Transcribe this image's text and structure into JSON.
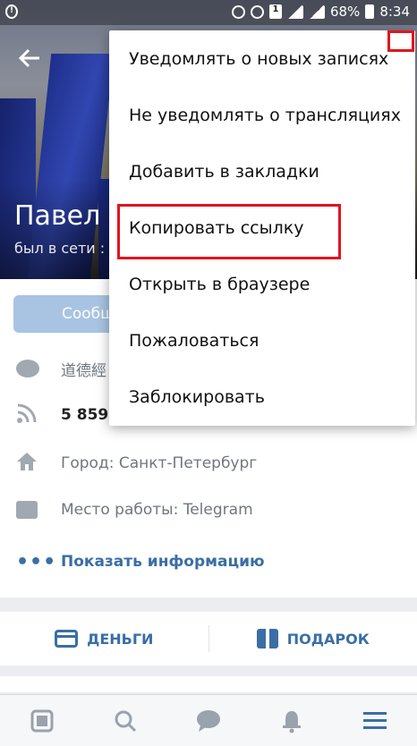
{
  "status_bar": {
    "battery_percent": "68%",
    "time": "8:34",
    "sim_label": "1"
  },
  "profile": {
    "name": "Павел Д",
    "status": "был в сети :",
    "message_button": "Сообщ"
  },
  "info_rows": [
    {
      "icon": "speech-bubble-icon",
      "text": "道德經"
    },
    {
      "icon": "rss-icon",
      "text": "5 859 "
    },
    {
      "icon": "home-icon",
      "text": "Город: Санкт-Петербург"
    },
    {
      "icon": "briefcase-icon",
      "text": "Место работы: Telegram"
    },
    {
      "icon": "more-dots-icon",
      "text": "Показать информацию"
    }
  ],
  "actions": {
    "money_label": "ДЕНЬГИ",
    "gift_label": "ПОДАРОК"
  },
  "menu": {
    "items": [
      "Уведомлять о новых записях",
      "Не уведомлять о трансляциях",
      "Добавить в закладки",
      "Копировать ссылку",
      "Открыть в браузере",
      "Пожаловаться",
      "Заблокировать"
    ]
  },
  "bottom_nav": [
    {
      "icon": "news-feed-icon"
    },
    {
      "icon": "search-icon"
    },
    {
      "icon": "messages-icon"
    },
    {
      "icon": "notifications-bell-icon"
    },
    {
      "icon": "menu-hamburger-icon"
    }
  ],
  "colors": {
    "accent": "#3a6ea5",
    "highlight": "#e0151e",
    "button_disabled": "#a9c4e3"
  }
}
